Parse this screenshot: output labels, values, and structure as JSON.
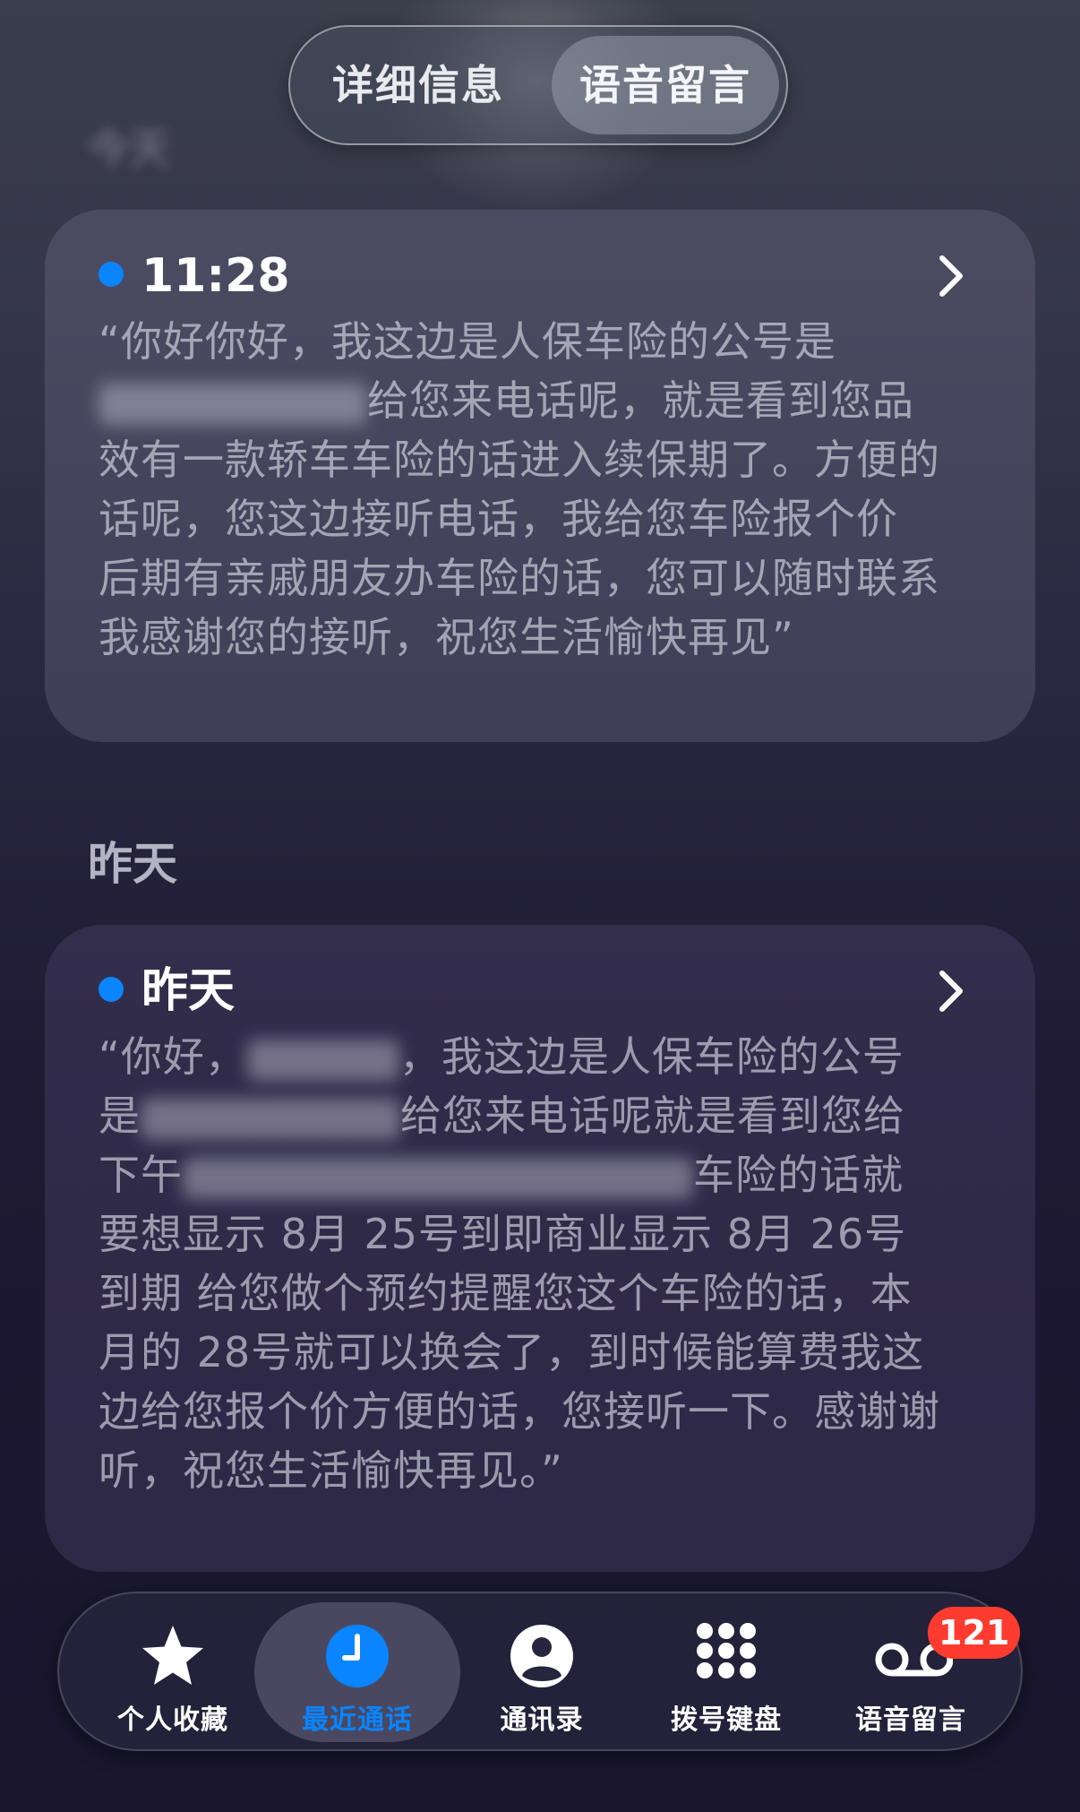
{
  "segmented_control": {
    "left_label": "详细信息",
    "right_label": "语音留言",
    "selected": "语音留言"
  },
  "sections": {
    "today_header": "今天",
    "yesterday_header": "昨天"
  },
  "voicemails": [
    {
      "time": "11:28",
      "unread": true,
      "transcript_parts": [
        "“你好你好，我这边是人保车险的公号是",
        "给您来电话呢，就是看到您品效有一款轿车车险的话进入续保期了。方便的话呢，您这边接听电话，我给您车险报个价 后期有亲戚朋友办车险的话，您可以随时联系我感谢您的接听，祝您生活愉快再见”"
      ]
    },
    {
      "time": "昨天",
      "unread": true,
      "transcript_parts": [
        "“你好，",
        "，我这边是人保车险的公号是",
        "给您来电话呢就是看到您给下午",
        "车险的话就要想显示 8月 25号到即商业显示 8月 26号到期 给您做个预约提醒您这个车险的话，本月的 28号就可以换会了，到时候能算费我这边给您报个价方便的话，您接听一下。感谢谢听，祝您生活愉快再见。”"
      ]
    }
  ],
  "tabbar": {
    "tabs": [
      {
        "label": "个人收藏",
        "icon": "star-icon",
        "active": false
      },
      {
        "label": "最近通话",
        "icon": "clock-icon",
        "active": true
      },
      {
        "label": "通讯录",
        "icon": "person-icon",
        "active": false
      },
      {
        "label": "拨号键盘",
        "icon": "keypad-icon",
        "active": false
      },
      {
        "label": "语音留言",
        "icon": "voicemail-icon",
        "active": false
      }
    ],
    "voicemail_badge": "121"
  },
  "colors": {
    "accent": "#0a84ff",
    "badge": "#ff3b30",
    "unread_dot": "#0a84ff"
  }
}
